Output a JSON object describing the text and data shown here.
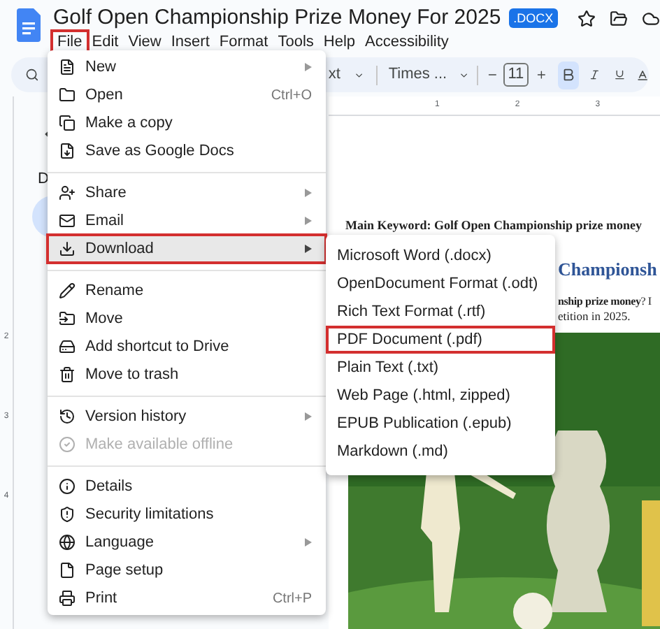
{
  "doc_title": "Golf Open Championship Prize Money For 2025",
  "badge": ".DOCX",
  "menubar": [
    {
      "label": "File",
      "selected": true
    },
    {
      "label": "Edit",
      "selected": false
    },
    {
      "label": "View",
      "selected": false
    },
    {
      "label": "Insert",
      "selected": false
    },
    {
      "label": "Format",
      "selected": false
    },
    {
      "label": "Tools",
      "selected": false
    },
    {
      "label": "Help",
      "selected": false
    },
    {
      "label": "Accessibility",
      "selected": false
    }
  ],
  "toolbar": {
    "style_fragment": "xt",
    "font": "Times ...",
    "font_size": "11",
    "bold_on": true
  },
  "side_panel": {
    "letter": "D"
  },
  "ruler_h": [
    "1",
    "2",
    "3"
  ],
  "ruler_v": [
    "2",
    "3",
    "4"
  ],
  "file_menu": [
    [
      {
        "label": "New",
        "has_submenu": true,
        "disabled": false,
        "selected": false
      },
      {
        "label": "Open",
        "shortcut": "Ctrl+O",
        "has_submenu": false,
        "disabled": false,
        "selected": false
      },
      {
        "label": "Make a copy",
        "has_submenu": false,
        "disabled": false,
        "selected": false
      },
      {
        "label": "Save as Google Docs",
        "has_submenu": false,
        "disabled": false,
        "selected": false
      }
    ],
    [
      {
        "label": "Share",
        "has_submenu": true,
        "disabled": false,
        "selected": false
      },
      {
        "label": "Email",
        "has_submenu": true,
        "disabled": false,
        "selected": false
      },
      {
        "label": "Download",
        "has_submenu": true,
        "disabled": false,
        "selected": true
      }
    ],
    [
      {
        "label": "Rename",
        "has_submenu": false,
        "disabled": false,
        "selected": false
      },
      {
        "label": "Move",
        "has_submenu": false,
        "disabled": false,
        "selected": false
      },
      {
        "label": "Add shortcut to Drive",
        "has_submenu": false,
        "disabled": false,
        "selected": false
      },
      {
        "label": "Move to trash",
        "has_submenu": false,
        "disabled": false,
        "selected": false
      }
    ],
    [
      {
        "label": "Version history",
        "has_submenu": true,
        "disabled": false,
        "selected": false
      },
      {
        "label": "Make available offline",
        "has_submenu": false,
        "disabled": true,
        "selected": false
      }
    ],
    [
      {
        "label": "Details",
        "has_submenu": false,
        "disabled": false,
        "selected": false
      },
      {
        "label": "Security limitations",
        "has_submenu": false,
        "disabled": false,
        "selected": false
      },
      {
        "label": "Language",
        "has_submenu": true,
        "disabled": false,
        "selected": false
      },
      {
        "label": "Page setup",
        "has_submenu": false,
        "disabled": false,
        "selected": false
      },
      {
        "label": "Print",
        "shortcut": "Ctrl+P",
        "has_submenu": false,
        "disabled": false,
        "selected": false
      }
    ]
  ],
  "download_menu": [
    {
      "label": "Microsoft Word (.docx)",
      "selected": false
    },
    {
      "label": "OpenDocument Format (.odt)",
      "selected": false
    },
    {
      "label": "Rich Text Format (.rtf)",
      "selected": false
    },
    {
      "label": "PDF Document (.pdf)",
      "selected": true
    },
    {
      "label": "Plain Text (.txt)",
      "selected": false
    },
    {
      "label": "Web Page (.html, zipped)",
      "selected": false
    },
    {
      "label": "EPUB Publication (.epub)",
      "selected": false
    },
    {
      "label": "Markdown (.md)",
      "selected": false
    }
  ],
  "document": {
    "keyword": "Main Keyword: Golf Open Championship prize money",
    "heading": "Championsh",
    "line_1": "**nship prize money**? I",
    "line_2": "etition in 2025."
  }
}
